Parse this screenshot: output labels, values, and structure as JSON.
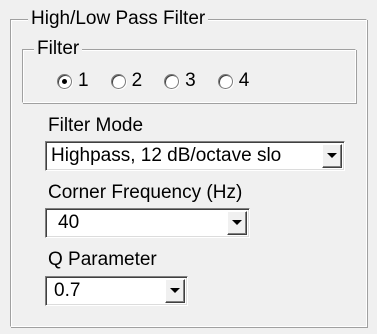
{
  "group": {
    "title": "High/Low Pass Filter"
  },
  "filter": {
    "title": "Filter",
    "options": [
      "1",
      "2",
      "3",
      "4"
    ],
    "selected_index": 0
  },
  "filter_mode": {
    "label": "Filter Mode",
    "value": "Highpass, 12 dB/octave slo"
  },
  "corner_frequency": {
    "label": "Corner Frequency (Hz)",
    "value": "40"
  },
  "q_parameter": {
    "label": "Q Parameter",
    "value": "0.7"
  },
  "icons": {
    "dropdown": "chevron-down-icon",
    "radio_checked": "radio-checked-icon",
    "radio_unchecked": "radio-unchecked-icon"
  }
}
